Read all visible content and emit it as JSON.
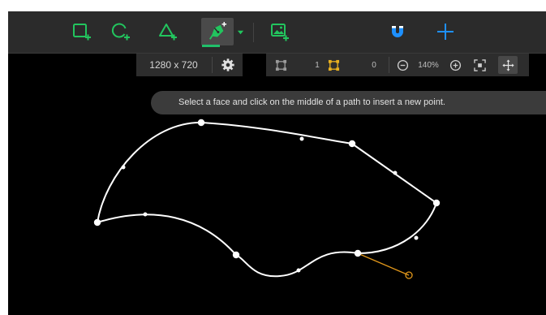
{
  "toolbar": {
    "tools": [
      {
        "name": "add-rectangle-tool",
        "icon": "rectangle-plus-icon"
      },
      {
        "name": "add-circle-tool",
        "icon": "circle-plus-icon"
      },
      {
        "name": "add-triangle-tool",
        "icon": "triangle-plus-icon"
      },
      {
        "name": "pen-tool",
        "icon": "pen-plus-icon",
        "active": true
      },
      {
        "name": "add-image-tool",
        "icon": "image-plus-icon"
      },
      {
        "name": "magnet-snap-tool",
        "icon": "magnet-icon"
      },
      {
        "name": "crosshair-tool",
        "icon": "crosshair-icon"
      }
    ],
    "accent_green": "#22c55e",
    "accent_blue": "#1e90ff"
  },
  "canvas_info": {
    "resolution": "1280 x 720"
  },
  "view_bar": {
    "vertex_count_a": "1",
    "vertex_count_b": "0",
    "zoom": "140%"
  },
  "hint": {
    "text": "Select a face and click on the middle of a path to insert a new point."
  },
  "colors": {
    "canvas_bg": "#000000",
    "path_stroke": "#ffffff",
    "handle": "#e0961a"
  }
}
